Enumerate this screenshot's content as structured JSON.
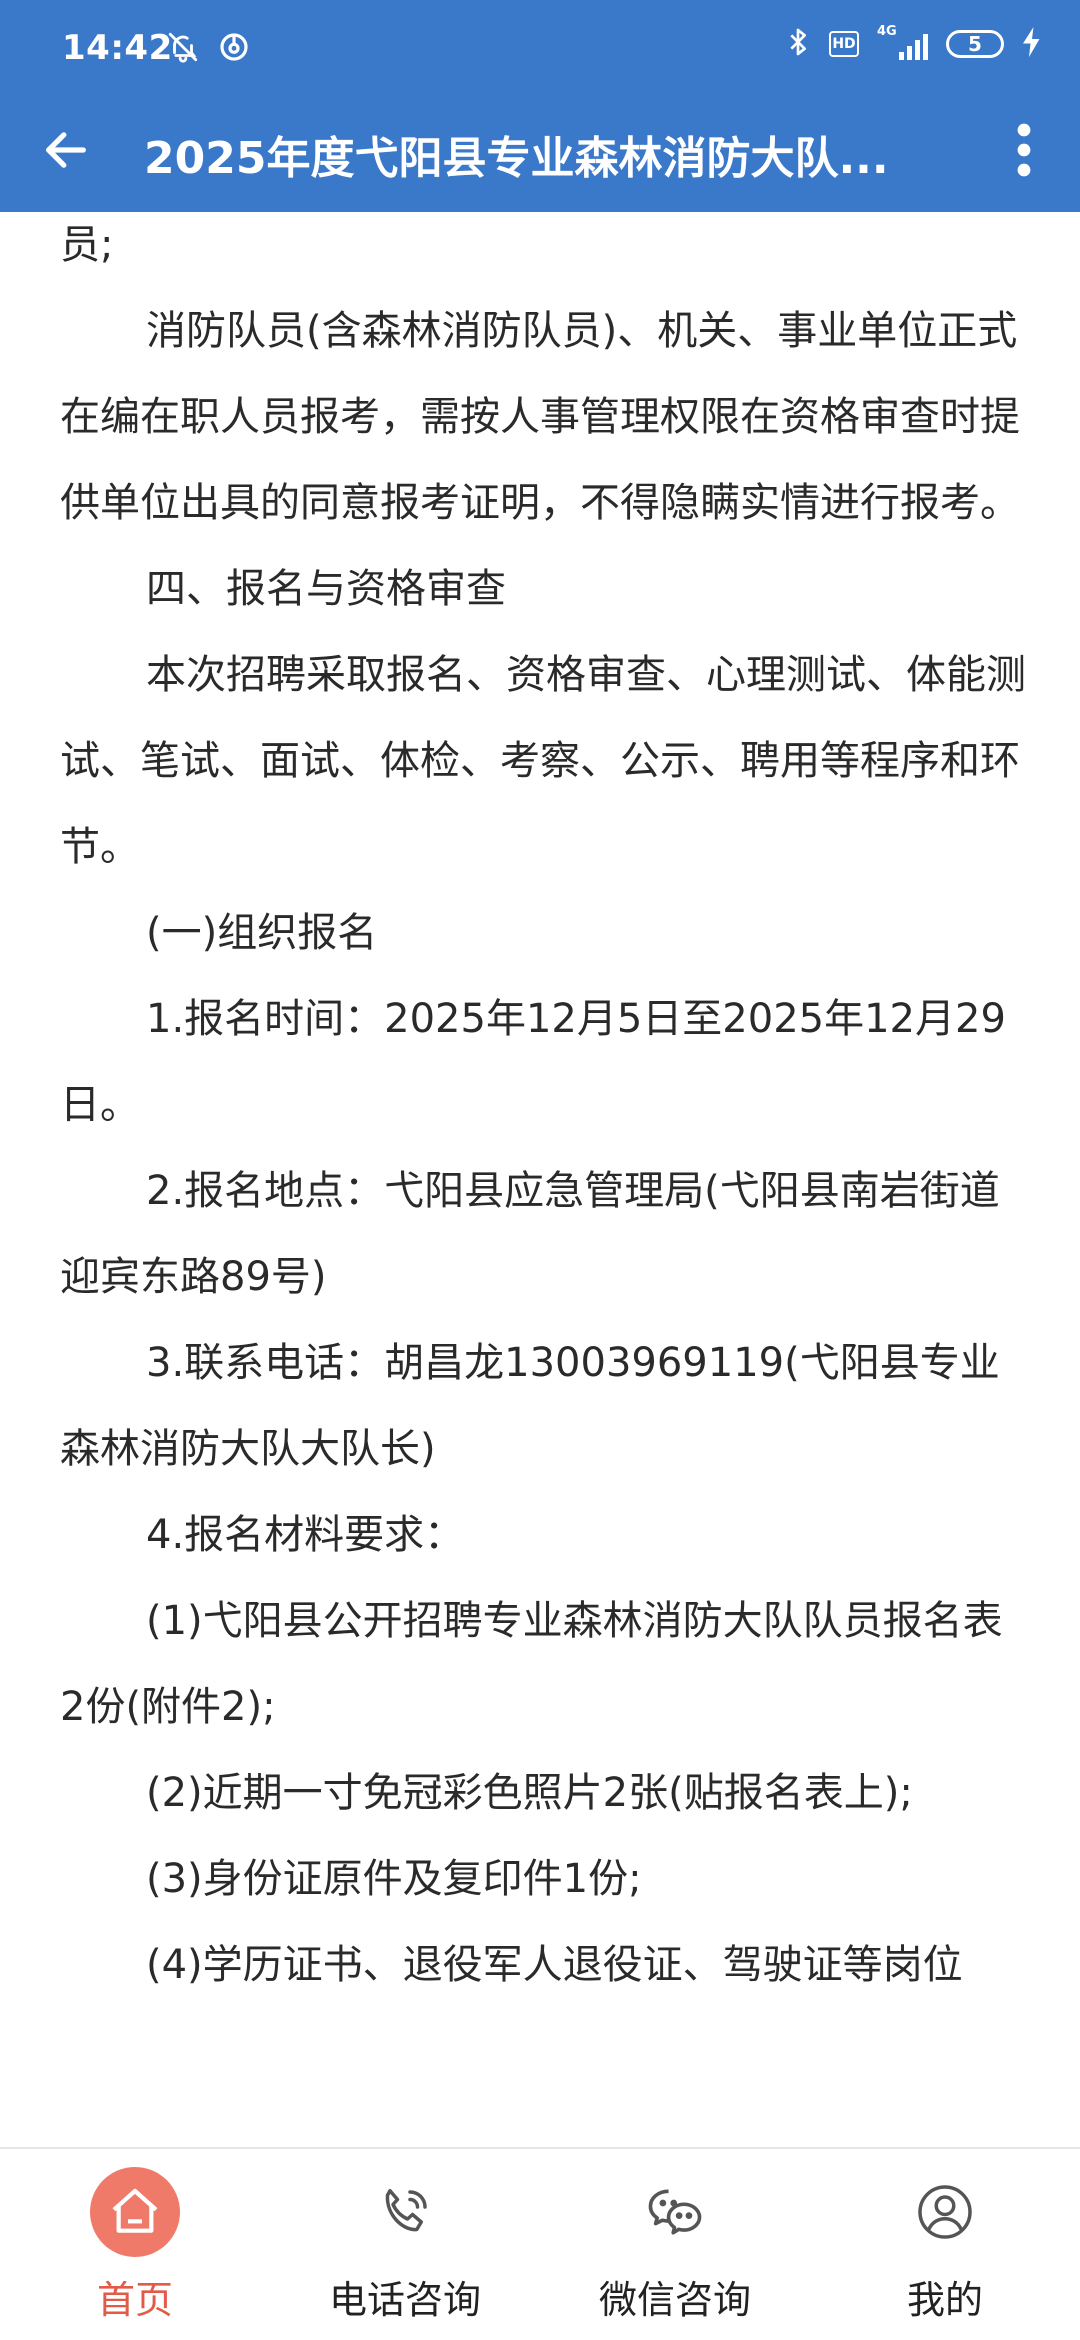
{
  "status_bar": {
    "time": "14:42",
    "network": "4G",
    "hd": "HD",
    "battery": "5"
  },
  "app_bar": {
    "title": "2025年度弋阳县专业森林消防大队..."
  },
  "article": {
    "paragraphs": [
      {
        "text": "员;",
        "indent": false
      },
      {
        "text": "消防队员(含森林消防队员)、机关、事业单位正式在编在职人员报考，需按人事管理权限在资格审查时提供单位出具的同意报考证明，不得隐瞒实情进行报考。",
        "indent": true
      },
      {
        "text": "四、报名与资格审查",
        "indent": true
      },
      {
        "text": "本次招聘采取报名、资格审查、心理测试、体能测试、笔试、面试、体检、考察、公示、聘用等程序和环节。",
        "indent": true
      },
      {
        "text": "(一)组织报名",
        "indent": true
      },
      {
        "text": "1.报名时间：2025年12月5日至2025年12月29日。",
        "indent": true
      },
      {
        "text": "2.报名地点：弋阳县应急管理局(弋阳县南岩街道迎宾东路89号)",
        "indent": true
      },
      {
        "text": "3.联系电话：胡昌龙13003969119(弋阳县专业森林消防大队大队长)",
        "indent": true
      },
      {
        "text": "4.报名材料要求：",
        "indent": true
      },
      {
        "text": "(1)弋阳县公开招聘专业森林消防大队队员报名表2份(附件2);",
        "indent": true
      },
      {
        "text": "(2)近期一寸免冠彩色照片2张(贴报名表上);",
        "indent": true
      },
      {
        "text": "(3)身份证原件及复印件1份;",
        "indent": true
      },
      {
        "text": "(4)学历证书、退役军人退役证、驾驶证等岗位",
        "indent": true
      }
    ]
  },
  "bottom_nav": {
    "items": [
      {
        "label": "首页",
        "icon": "home-icon",
        "active": true
      },
      {
        "label": "电话咨询",
        "icon": "phone-icon",
        "active": false
      },
      {
        "label": "微信咨询",
        "icon": "wechat-icon",
        "active": false
      },
      {
        "label": "我的",
        "icon": "user-icon",
        "active": false
      }
    ]
  },
  "colors": {
    "header_bg": "#3a78c9",
    "active_red": "#e25a48",
    "active_icon_bg": "#f07a6a",
    "text": "#2a2a2a"
  }
}
